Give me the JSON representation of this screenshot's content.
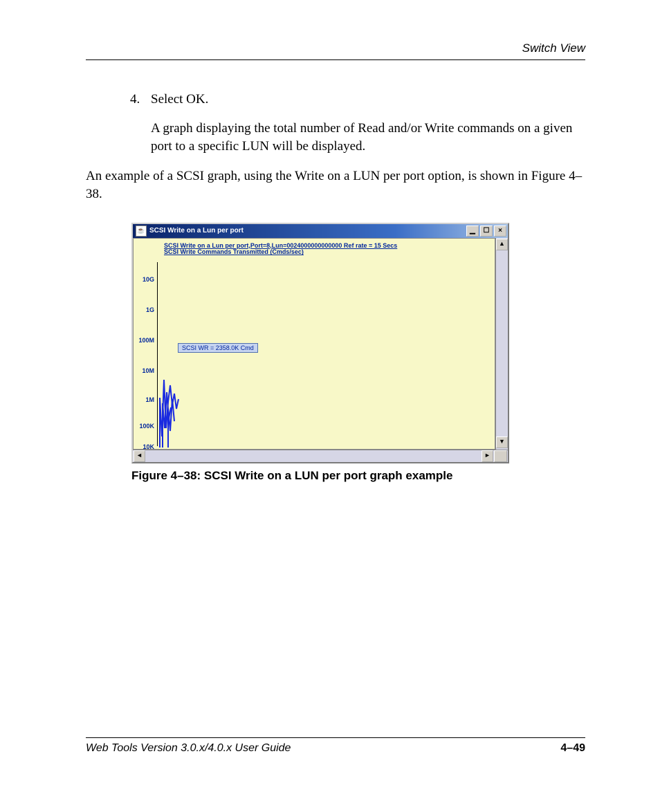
{
  "header": {
    "section": "Switch View"
  },
  "body": {
    "step_number": "4.",
    "step_text": "Select OK.",
    "step_desc": "A graph displaying the total number of Read and/or Write commands on a given port to a specific LUN will be displayed.",
    "intro": "An example of a SCSI graph, using the Write on a LUN per port option, is shown in Figure 4–38."
  },
  "window": {
    "title": "SCSI Write on a Lun per port",
    "sub_line1": "SCSI Write on a Lun per port,Port=8,Lun=0024000000000000 Ref rate = 15 Secs",
    "sub_line2": "SCSI Write Commands Transmitted (Cmds/sec)",
    "tooltip": "SCSI WR = 2358.0K Cmd",
    "y_ticks": [
      "10G",
      "1G",
      "100M",
      "10M",
      "1M",
      "100K",
      "10K"
    ],
    "min_glyph": "▁",
    "max_glyph": "☐",
    "close_glyph": "×",
    "up_glyph": "▲",
    "down_glyph": "▼",
    "left_glyph": "◄",
    "right_glyph": "►"
  },
  "chart_data": {
    "type": "line",
    "title": "SCSI Write on a Lun per port,Port=8,Lun=0024000000000000 Ref rate = 15 Secs",
    "ylabel": "SCSI Write Commands Transmitted (Cmds/sec)",
    "xlabel": "",
    "y_scale": "log",
    "y_ticks": [
      "10K",
      "100K",
      "1M",
      "10M",
      "100M",
      "1G",
      "10G"
    ],
    "ylim_log10": [
      4,
      10
    ],
    "series": [
      {
        "name": "SCSI WR",
        "unit": "Cmd",
        "values_approx_K": [
          1400,
          200,
          2358,
          500,
          2100,
          1200,
          2200,
          1800
        ],
        "tooltip_value": "2358.0K"
      }
    ]
  },
  "figure": {
    "caption": "Figure 4–38:  SCSI Write on a LUN per port graph example"
  },
  "footer": {
    "left": "Web Tools Version 3.0.x/4.0.x User Guide",
    "right": "4–49"
  }
}
